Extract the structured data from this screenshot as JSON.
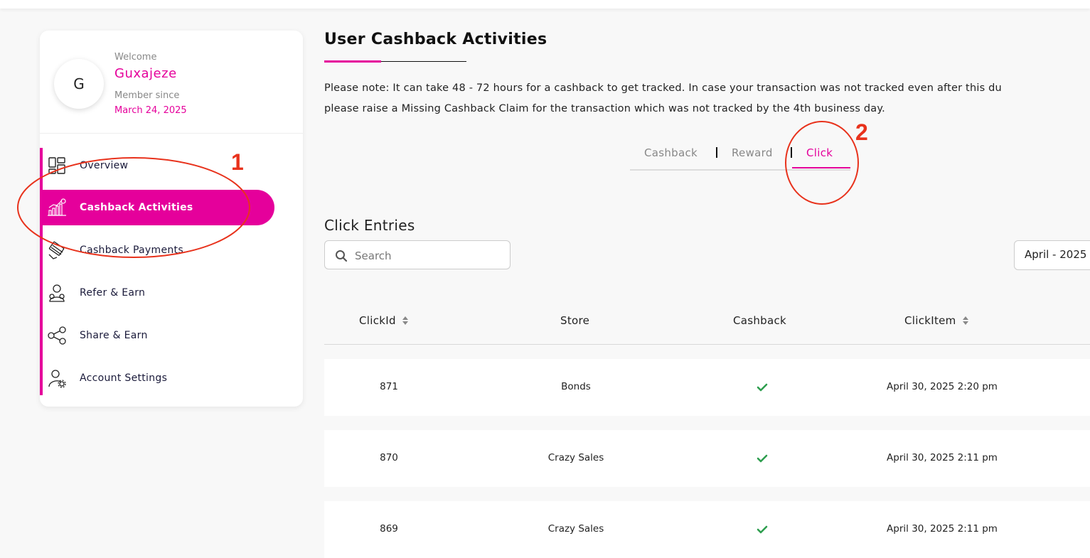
{
  "profile": {
    "initial": "G",
    "welcome": "Welcome",
    "name": "Guxajeze",
    "member_since_label": "Member since",
    "member_since_date": "March 24, 2025"
  },
  "sidebar": {
    "items": [
      {
        "label": "Overview",
        "icon": "overview-grid-icon"
      },
      {
        "label": "Cashback Activities",
        "icon": "chart-growth-icon",
        "active": true
      },
      {
        "label": "Cashback Payments",
        "icon": "payment-card-icon"
      },
      {
        "label": "Refer & Earn",
        "icon": "refer-user-icon"
      },
      {
        "label": "Share & Earn",
        "icon": "share-network-icon"
      },
      {
        "label": "Account Settings",
        "icon": "user-settings-icon"
      }
    ]
  },
  "main": {
    "title": "User Cashback Activities",
    "note_line1": "Please note: It can take 48 - 72  hours for a cashback to get tracked. In case your transaction was not tracked even after this du",
    "note_line2": "please raise a Missing Cashback Claim for the transaction which was not tracked by the 4th business day.",
    "tabs": [
      {
        "label": "Cashback"
      },
      {
        "label": "Reward"
      },
      {
        "label": "Click",
        "active": true
      }
    ],
    "section_title": "Click Entries",
    "search_placeholder": "Search",
    "month_filter": "April - 2025"
  },
  "table": {
    "columns": [
      "ClickId",
      "Store",
      "Cashback",
      "ClickItem"
    ],
    "rows": [
      {
        "click_id": "871",
        "store": "Bonds",
        "cashback": "check-icon",
        "click_item": "April 30, 2025 2:20 pm"
      },
      {
        "click_id": "870",
        "store": "Crazy Sales",
        "cashback": "check-icon",
        "click_item": "April 30, 2025 2:11 pm"
      },
      {
        "click_id": "869",
        "store": "Crazy Sales",
        "cashback": "check-icon",
        "click_item": "April 30, 2025 2:11 pm"
      }
    ]
  },
  "annotations": {
    "marker_1": "1",
    "marker_2": "2",
    "color": "#e8321c"
  },
  "colors": {
    "accent": "#e5009b",
    "success": "#2e9e4f"
  }
}
